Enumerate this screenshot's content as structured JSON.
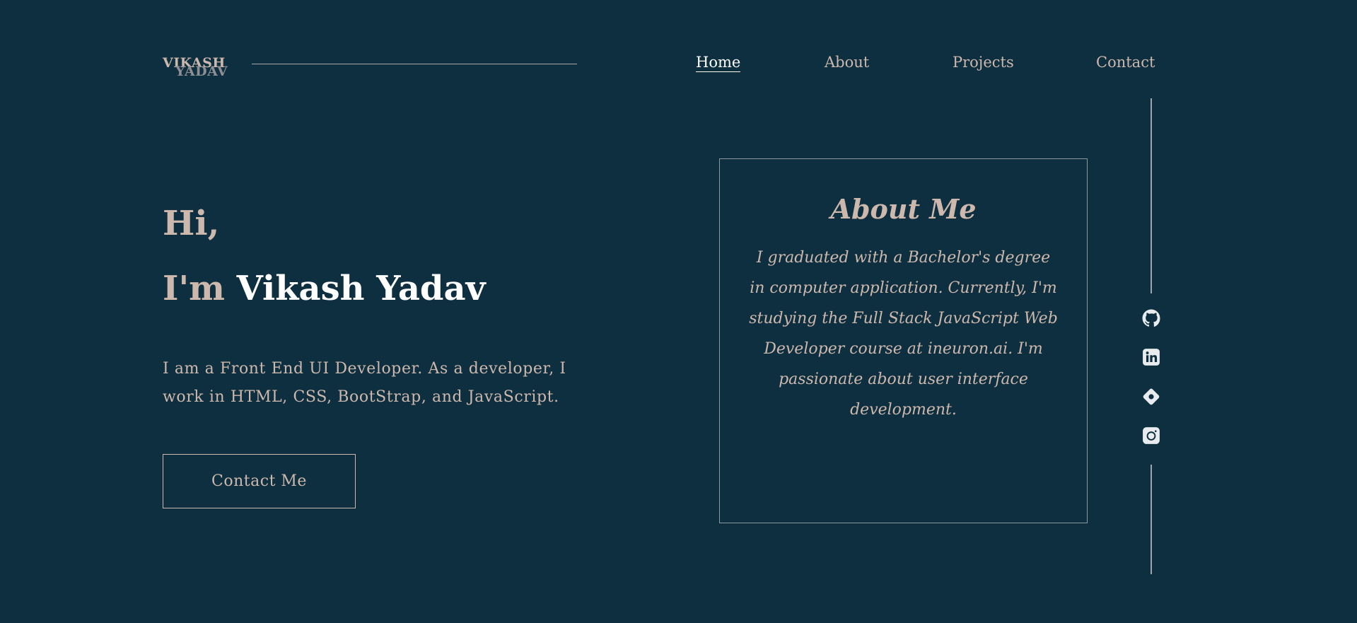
{
  "header": {
    "logo_first": "VIKASH",
    "logo_second": "YADAV",
    "nav": [
      {
        "label": "Home",
        "active": true
      },
      {
        "label": "About",
        "active": false
      },
      {
        "label": "Projects",
        "active": false
      },
      {
        "label": "Contact",
        "active": false
      }
    ]
  },
  "hero": {
    "greeting": "Hi,",
    "im_prefix": "I'm",
    "name": "Vikash Yadav",
    "intro": "I am a Front End UI Developer. As a developer, I work in HTML, CSS, BootStrap, and JavaScript.",
    "cta_label": "Contact Me"
  },
  "about": {
    "title": "About Me",
    "text": "I graduated with a Bachelor's degree in computer application. Currently, I'm studying the Full Stack JavaScript Web Developer course at ineuron.ai. I'm passionate about user interface development."
  },
  "social": [
    {
      "icon": "github-icon"
    },
    {
      "icon": "linkedin-icon"
    },
    {
      "icon": "diamond-icon"
    },
    {
      "icon": "instagram-icon"
    }
  ],
  "colors": {
    "background": "#0e2f3f",
    "accent": "#cdb8ad",
    "highlight": "#ffffff",
    "muted": "#8e8e93",
    "icon": "#e8ecef"
  }
}
